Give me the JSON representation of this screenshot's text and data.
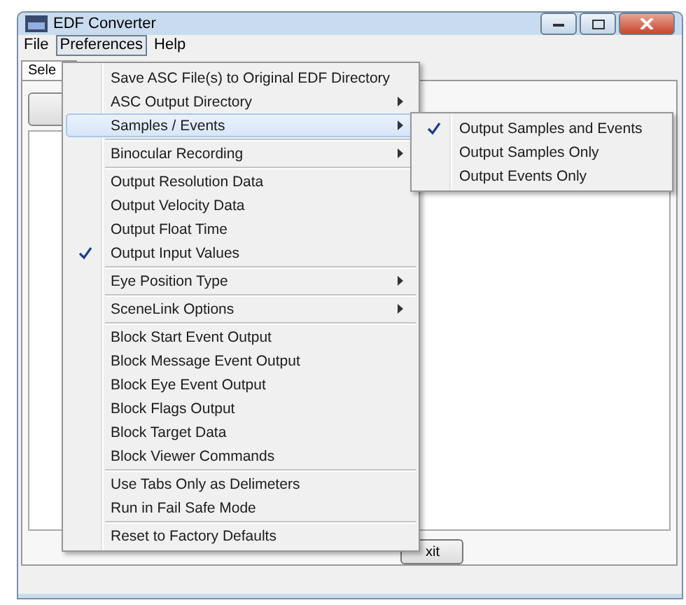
{
  "window": {
    "title": "EDF Converter"
  },
  "menubar": [
    {
      "label": "File",
      "selected": false
    },
    {
      "label": "Preferences",
      "selected": true
    },
    {
      "label": "Help",
      "selected": false
    }
  ],
  "tab": {
    "label": "Sele"
  },
  "exit_button": {
    "label": "xit"
  },
  "menu": [
    {
      "kind": "item",
      "label": "Save ASC File(s) to Original EDF Directory",
      "checked": false,
      "submenu": false,
      "highlighted": false
    },
    {
      "kind": "item",
      "label": "ASC Output Directory",
      "checked": false,
      "submenu": true,
      "highlighted": false
    },
    {
      "kind": "item",
      "label": "Samples / Events",
      "checked": false,
      "submenu": true,
      "highlighted": true
    },
    {
      "kind": "separator"
    },
    {
      "kind": "item",
      "label": "Binocular Recording",
      "checked": false,
      "submenu": true,
      "highlighted": false
    },
    {
      "kind": "separator"
    },
    {
      "kind": "item",
      "label": "Output Resolution Data",
      "checked": false,
      "submenu": false,
      "highlighted": false
    },
    {
      "kind": "item",
      "label": "Output Velocity Data",
      "checked": false,
      "submenu": false,
      "highlighted": false
    },
    {
      "kind": "item",
      "label": "Output Float Time",
      "checked": false,
      "submenu": false,
      "highlighted": false
    },
    {
      "kind": "item",
      "label": "Output Input Values",
      "checked": true,
      "submenu": false,
      "highlighted": false
    },
    {
      "kind": "separator"
    },
    {
      "kind": "item",
      "label": "Eye Position Type",
      "checked": false,
      "submenu": true,
      "highlighted": false
    },
    {
      "kind": "separator"
    },
    {
      "kind": "item",
      "label": "SceneLink Options",
      "checked": false,
      "submenu": true,
      "highlighted": false
    },
    {
      "kind": "separator"
    },
    {
      "kind": "item",
      "label": "Block Start Event Output",
      "checked": false,
      "submenu": false,
      "highlighted": false
    },
    {
      "kind": "item",
      "label": "Block Message Event Output",
      "checked": false,
      "submenu": false,
      "highlighted": false
    },
    {
      "kind": "item",
      "label": "Block Eye Event Output",
      "checked": false,
      "submenu": false,
      "highlighted": false
    },
    {
      "kind": "item",
      "label": "Block Flags Output",
      "checked": false,
      "submenu": false,
      "highlighted": false
    },
    {
      "kind": "item",
      "label": "Block Target Data",
      "checked": false,
      "submenu": false,
      "highlighted": false
    },
    {
      "kind": "item",
      "label": "Block Viewer Commands",
      "checked": false,
      "submenu": false,
      "highlighted": false
    },
    {
      "kind": "separator"
    },
    {
      "kind": "item",
      "label": "Use Tabs Only as Delimeters",
      "checked": false,
      "submenu": false,
      "highlighted": false
    },
    {
      "kind": "item",
      "label": "Run in Fail Safe Mode",
      "checked": false,
      "submenu": false,
      "highlighted": false
    },
    {
      "kind": "separator"
    },
    {
      "kind": "item",
      "label": "Reset to Factory Defaults",
      "checked": false,
      "submenu": false,
      "highlighted": false
    }
  ],
  "submenu": [
    {
      "label": "Output Samples and Events",
      "checked": true
    },
    {
      "label": "Output Samples Only",
      "checked": false
    },
    {
      "label": "Output Events Only",
      "checked": false
    }
  ]
}
